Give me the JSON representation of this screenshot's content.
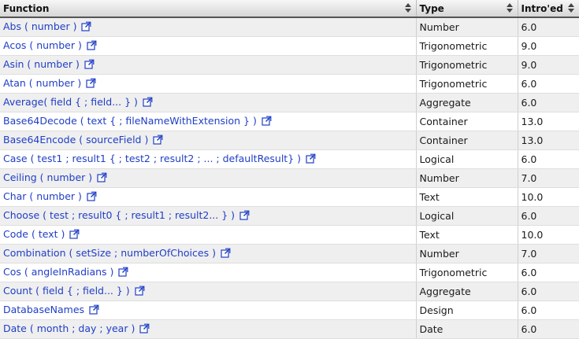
{
  "header": {
    "function": "Function",
    "type": "Type",
    "intro": "Intro'ed"
  },
  "colors": {
    "link": "#1f3ec6",
    "odd_row": "#efefef",
    "even_row": "#ffffff"
  },
  "rows": [
    {
      "func": "Abs ( number )",
      "type": "Number",
      "intro": "6.0"
    },
    {
      "func": "Acos ( number )",
      "type": "Trigonometric",
      "intro": "9.0"
    },
    {
      "func": "Asin ( number )",
      "type": "Trigonometric",
      "intro": "9.0"
    },
    {
      "func": "Atan ( number )",
      "type": "Trigonometric",
      "intro": "6.0"
    },
    {
      "func": "Average( field { ; field... } )",
      "type": "Aggregate",
      "intro": "6.0"
    },
    {
      "func": "Base64Decode ( text { ; fileNameWithExtension } )",
      "type": "Container",
      "intro": "13.0"
    },
    {
      "func": "Base64Encode ( sourceField )",
      "type": "Container",
      "intro": "13.0"
    },
    {
      "func": "Case ( test1 ; result1 { ; test2 ; result2 ; ... ; defaultResult} )",
      "type": "Logical",
      "intro": "6.0"
    },
    {
      "func": "Ceiling ( number )",
      "type": "Number",
      "intro": "7.0"
    },
    {
      "func": "Char ( number )",
      "type": "Text",
      "intro": "10.0"
    },
    {
      "func": "Choose ( test ; result0 { ; result1 ; result2... } )",
      "type": "Logical",
      "intro": "6.0"
    },
    {
      "func": "Code ( text )",
      "type": "Text",
      "intro": "10.0"
    },
    {
      "func": "Combination ( setSize ; numberOfChoices )",
      "type": "Number",
      "intro": "7.0"
    },
    {
      "func": "Cos ( angleInRadians )",
      "type": "Trigonometric",
      "intro": "6.0"
    },
    {
      "func": "Count ( field { ; field... } )",
      "type": "Aggregate",
      "intro": "6.0"
    },
    {
      "func": "DatabaseNames",
      "type": "Design",
      "intro": "6.0"
    },
    {
      "func": "Date ( month ; day ; year )",
      "type": "Date",
      "intro": "6.0"
    }
  ]
}
